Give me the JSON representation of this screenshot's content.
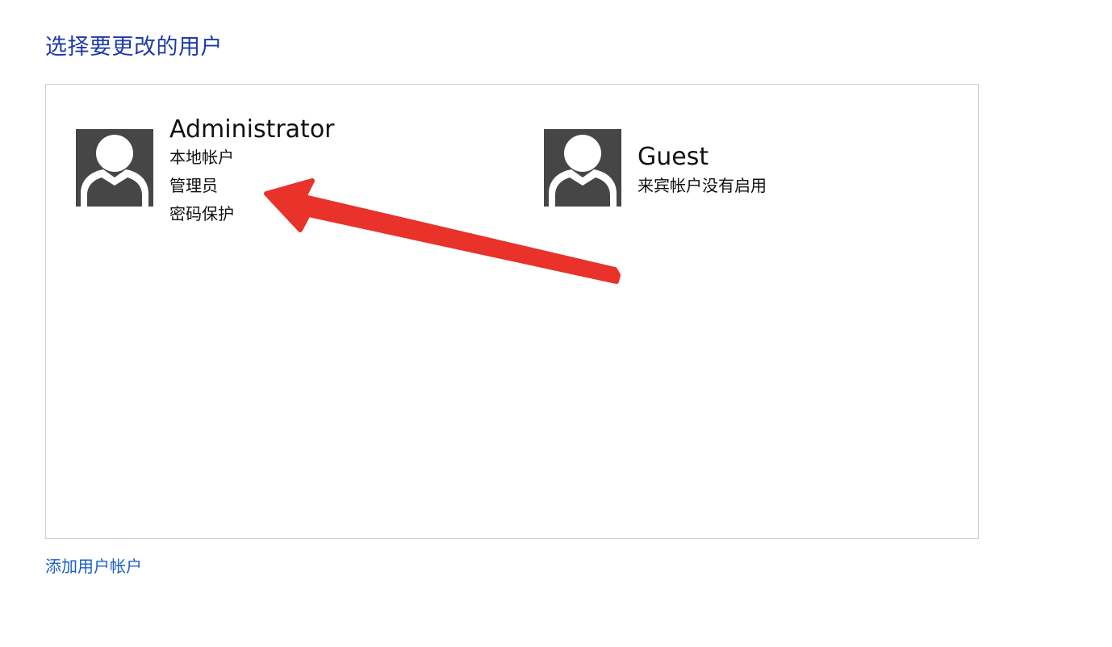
{
  "page": {
    "title": "选择要更改的用户"
  },
  "users": [
    {
      "name": "Administrator",
      "details": [
        "本地帐户",
        "管理员",
        "密码保护"
      ],
      "icon": "user-avatar-icon"
    },
    {
      "name": "Guest",
      "details": [
        "来宾帐户没有启用"
      ],
      "icon": "user-avatar-icon"
    }
  ],
  "footer": {
    "add_account_link": "添加用户帐户"
  },
  "colors": {
    "title": "#1e3aa8",
    "link": "#1a5fc8",
    "avatar_bg": "#464646",
    "panel_border": "#cfcfcf",
    "annotation_arrow": "#e8322a"
  }
}
